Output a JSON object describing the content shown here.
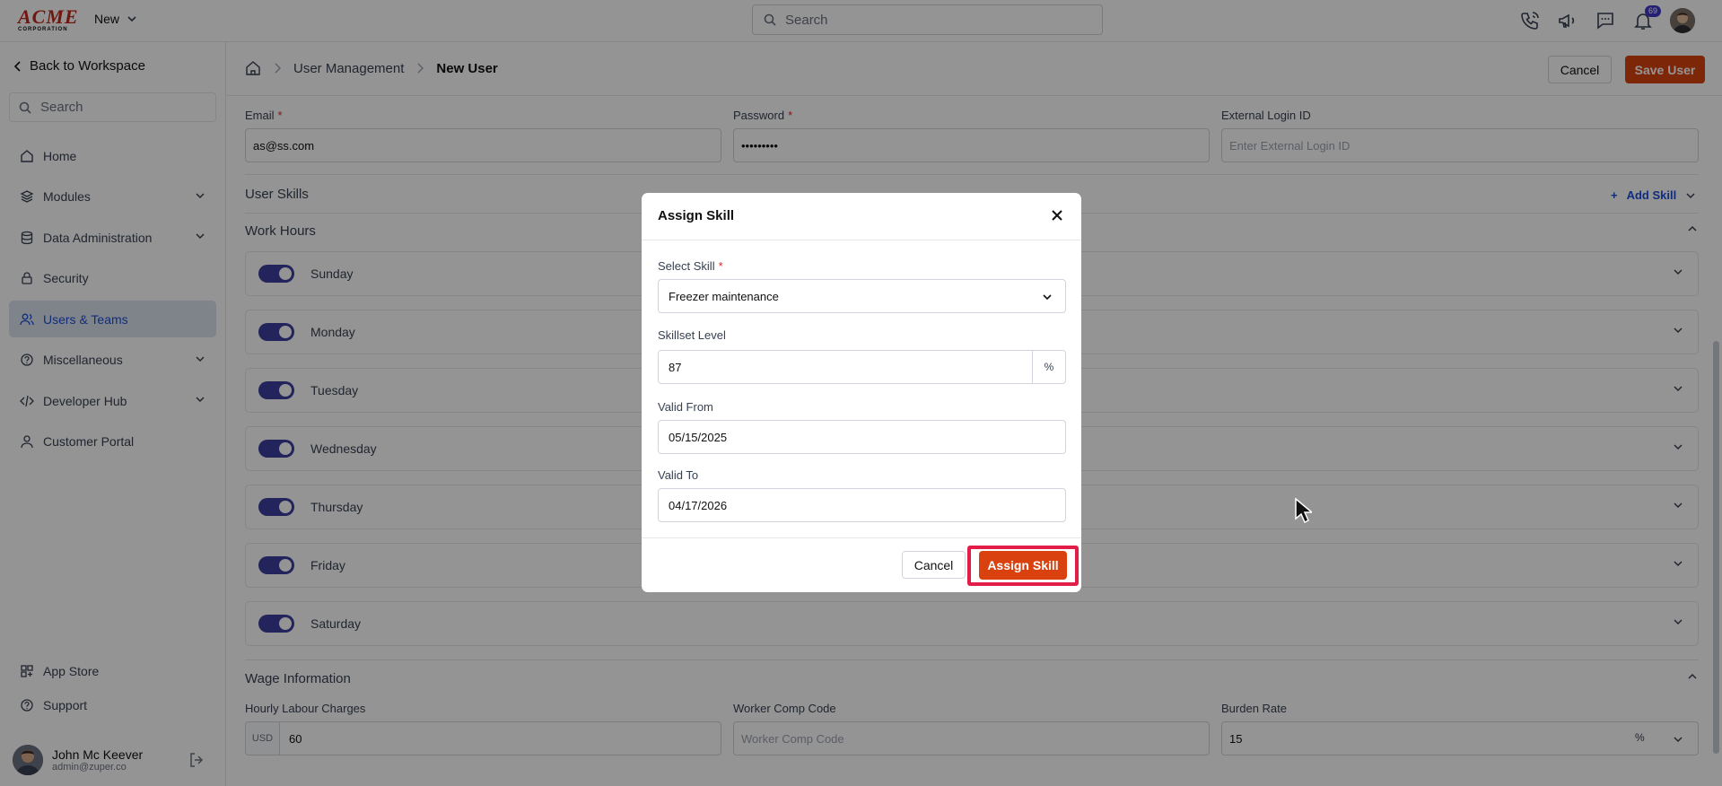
{
  "topbar": {
    "logo_text": "ACME",
    "logo_sub": "CORPORATION",
    "new_label": "New",
    "search_placeholder": "Search",
    "notification_count": "69"
  },
  "sidebar": {
    "back_label": "Back to Workspace",
    "search_placeholder": "Search",
    "items": [
      {
        "label": "Home",
        "icon": "home-icon"
      },
      {
        "label": "Modules",
        "icon": "layers-icon"
      },
      {
        "label": "Data Administration",
        "icon": "database-icon"
      },
      {
        "label": "Security",
        "icon": "lock-icon"
      },
      {
        "label": "Users & Teams",
        "icon": "users-icon",
        "active": true
      },
      {
        "label": "Miscellaneous",
        "icon": "help-circle-icon"
      },
      {
        "label": "Developer Hub",
        "icon": "code-icon"
      },
      {
        "label": "Customer Portal",
        "icon": "user-icon"
      }
    ],
    "bottom_items": [
      {
        "label": "App Store",
        "icon": "grid-icon"
      },
      {
        "label": "Support",
        "icon": "help-icon"
      }
    ],
    "user": {
      "name": "John Mc Keever",
      "email": "admin@zuper.co"
    }
  },
  "header": {
    "breadcrumb": [
      "User Management",
      "New User"
    ],
    "cancel_label": "Cancel",
    "save_label": "Save User"
  },
  "form": {
    "email_label": "Email",
    "email_value": "as@ss.com",
    "password_label": "Password",
    "password_value": "•••••••••",
    "external_label": "External Login ID",
    "external_placeholder": "Enter External Login ID",
    "skills_title": "User Skills",
    "add_skill_label": "Add Skill",
    "work_hours_title": "Work Hours",
    "days": [
      "Sunday",
      "Monday",
      "Tuesday",
      "Wednesday",
      "Thursday",
      "Friday",
      "Saturday"
    ],
    "wage_title": "Wage Information",
    "hourly_label": "Hourly Labour Charges",
    "currency": "USD",
    "hourly_value": "60",
    "comp_label": "Worker Comp Code",
    "comp_placeholder": "Worker Comp Code",
    "burden_label": "Burden Rate",
    "burden_value": "15"
  },
  "modal": {
    "title": "Assign Skill",
    "select_skill_label": "Select Skill",
    "select_skill_value": "Freezer maintenance",
    "level_label": "Skillset Level",
    "level_value": "87",
    "valid_from_label": "Valid From",
    "valid_from_value": "05/15/2025",
    "valid_to_label": "Valid To",
    "valid_to_value": "04/17/2026",
    "cancel_label": "Cancel",
    "assign_label": "Assign Skill"
  },
  "colors": {
    "primary": "#d9420e",
    "toggle_on": "#3b3f9e",
    "link": "#1d4ed8",
    "highlight_ring": "#e11d48"
  }
}
